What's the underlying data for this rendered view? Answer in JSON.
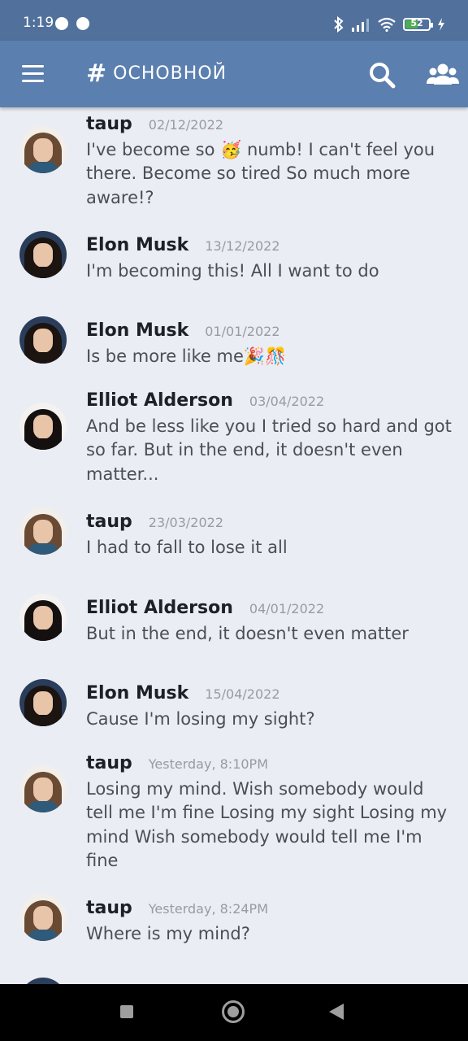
{
  "status_bar": {
    "time": "1:19",
    "battery": "52",
    "battery_level": 0.52
  },
  "app_bar": {
    "menu_icon": "hamburger-menu-icon",
    "channel_symbol": "#",
    "channel_name": "ОСНОВНОЙ",
    "search_icon": "search-icon",
    "members_icon": "users-icon"
  },
  "messages": [
    {
      "author": "taup",
      "date": "02/12/2022",
      "text": "I've become so 🥳 numb! I can't feel you there. Become so tired So much more aware!?"
    },
    {
      "author": "Elon Musk",
      "date": "13/12/2022",
      "text": "I'm becoming this! All I want to do"
    },
    {
      "author": "Elon Musk",
      "date": "01/01/2022",
      "text": "Is be more like me🎉🎊"
    },
    {
      "author": "Elliot Alderson",
      "date": "03/04/2022",
      "text": "And be less like you I tried so hard and got so far. But in the end, it doesn't even matter..."
    },
    {
      "author": "taup",
      "date": "23/03/2022",
      "text": "I had to fall to lose it all"
    },
    {
      "author": "Elliot Alderson",
      "date": "04/01/2022",
      "text": "But in the end, it doesn't even matter"
    },
    {
      "author": "Elon Musk",
      "date": "15/04/2022",
      "text": "Cause I'm losing my sight?"
    },
    {
      "author": "taup",
      "date": "Yesterday, 8:10PM",
      "text": "Losing my mind. Wish somebody would tell me I'm fine Losing my sight Losing my mind Wish somebody would tell me I'm fine"
    },
    {
      "author": "taup",
      "date": "Yesterday, 8:24PM",
      "text": "Where is my mind?"
    }
  ],
  "nav_bar": {
    "recents_icon": "square-recents-icon",
    "home_icon": "circle-home-icon",
    "back_icon": "triangle-back-icon"
  }
}
